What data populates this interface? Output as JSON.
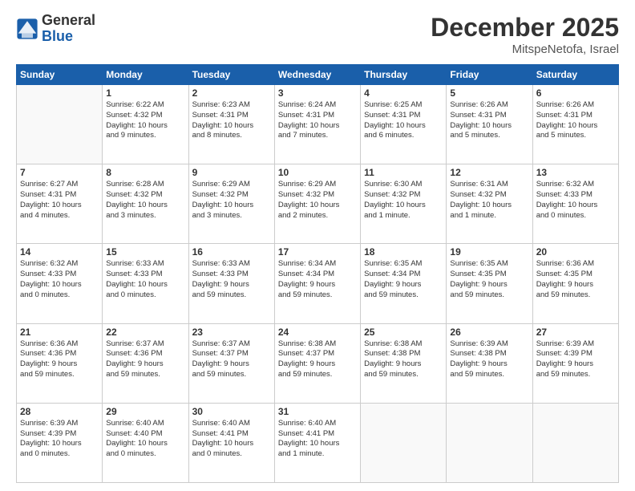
{
  "logo": {
    "general": "General",
    "blue": "Blue"
  },
  "title": "December 2025",
  "subtitle": "MitspeNetofa, Israel",
  "headers": [
    "Sunday",
    "Monday",
    "Tuesday",
    "Wednesday",
    "Thursday",
    "Friday",
    "Saturday"
  ],
  "weeks": [
    [
      {
        "day": "",
        "info": ""
      },
      {
        "day": "1",
        "info": "Sunrise: 6:22 AM\nSunset: 4:32 PM\nDaylight: 10 hours\nand 9 minutes."
      },
      {
        "day": "2",
        "info": "Sunrise: 6:23 AM\nSunset: 4:31 PM\nDaylight: 10 hours\nand 8 minutes."
      },
      {
        "day": "3",
        "info": "Sunrise: 6:24 AM\nSunset: 4:31 PM\nDaylight: 10 hours\nand 7 minutes."
      },
      {
        "day": "4",
        "info": "Sunrise: 6:25 AM\nSunset: 4:31 PM\nDaylight: 10 hours\nand 6 minutes."
      },
      {
        "day": "5",
        "info": "Sunrise: 6:26 AM\nSunset: 4:31 PM\nDaylight: 10 hours\nand 5 minutes."
      },
      {
        "day": "6",
        "info": "Sunrise: 6:26 AM\nSunset: 4:31 PM\nDaylight: 10 hours\nand 5 minutes."
      }
    ],
    [
      {
        "day": "7",
        "info": "Sunrise: 6:27 AM\nSunset: 4:31 PM\nDaylight: 10 hours\nand 4 minutes."
      },
      {
        "day": "8",
        "info": "Sunrise: 6:28 AM\nSunset: 4:32 PM\nDaylight: 10 hours\nand 3 minutes."
      },
      {
        "day": "9",
        "info": "Sunrise: 6:29 AM\nSunset: 4:32 PM\nDaylight: 10 hours\nand 3 minutes."
      },
      {
        "day": "10",
        "info": "Sunrise: 6:29 AM\nSunset: 4:32 PM\nDaylight: 10 hours\nand 2 minutes."
      },
      {
        "day": "11",
        "info": "Sunrise: 6:30 AM\nSunset: 4:32 PM\nDaylight: 10 hours\nand 1 minute."
      },
      {
        "day": "12",
        "info": "Sunrise: 6:31 AM\nSunset: 4:32 PM\nDaylight: 10 hours\nand 1 minute."
      },
      {
        "day": "13",
        "info": "Sunrise: 6:32 AM\nSunset: 4:33 PM\nDaylight: 10 hours\nand 0 minutes."
      }
    ],
    [
      {
        "day": "14",
        "info": "Sunrise: 6:32 AM\nSunset: 4:33 PM\nDaylight: 10 hours\nand 0 minutes."
      },
      {
        "day": "15",
        "info": "Sunrise: 6:33 AM\nSunset: 4:33 PM\nDaylight: 10 hours\nand 0 minutes."
      },
      {
        "day": "16",
        "info": "Sunrise: 6:33 AM\nSunset: 4:33 PM\nDaylight: 9 hours\nand 59 minutes."
      },
      {
        "day": "17",
        "info": "Sunrise: 6:34 AM\nSunset: 4:34 PM\nDaylight: 9 hours\nand 59 minutes."
      },
      {
        "day": "18",
        "info": "Sunrise: 6:35 AM\nSunset: 4:34 PM\nDaylight: 9 hours\nand 59 minutes."
      },
      {
        "day": "19",
        "info": "Sunrise: 6:35 AM\nSunset: 4:35 PM\nDaylight: 9 hours\nand 59 minutes."
      },
      {
        "day": "20",
        "info": "Sunrise: 6:36 AM\nSunset: 4:35 PM\nDaylight: 9 hours\nand 59 minutes."
      }
    ],
    [
      {
        "day": "21",
        "info": "Sunrise: 6:36 AM\nSunset: 4:36 PM\nDaylight: 9 hours\nand 59 minutes."
      },
      {
        "day": "22",
        "info": "Sunrise: 6:37 AM\nSunset: 4:36 PM\nDaylight: 9 hours\nand 59 minutes."
      },
      {
        "day": "23",
        "info": "Sunrise: 6:37 AM\nSunset: 4:37 PM\nDaylight: 9 hours\nand 59 minutes."
      },
      {
        "day": "24",
        "info": "Sunrise: 6:38 AM\nSunset: 4:37 PM\nDaylight: 9 hours\nand 59 minutes."
      },
      {
        "day": "25",
        "info": "Sunrise: 6:38 AM\nSunset: 4:38 PM\nDaylight: 9 hours\nand 59 minutes."
      },
      {
        "day": "26",
        "info": "Sunrise: 6:39 AM\nSunset: 4:38 PM\nDaylight: 9 hours\nand 59 minutes."
      },
      {
        "day": "27",
        "info": "Sunrise: 6:39 AM\nSunset: 4:39 PM\nDaylight: 9 hours\nand 59 minutes."
      }
    ],
    [
      {
        "day": "28",
        "info": "Sunrise: 6:39 AM\nSunset: 4:39 PM\nDaylight: 10 hours\nand 0 minutes."
      },
      {
        "day": "29",
        "info": "Sunrise: 6:40 AM\nSunset: 4:40 PM\nDaylight: 10 hours\nand 0 minutes."
      },
      {
        "day": "30",
        "info": "Sunrise: 6:40 AM\nSunset: 4:41 PM\nDaylight: 10 hours\nand 0 minutes."
      },
      {
        "day": "31",
        "info": "Sunrise: 6:40 AM\nSunset: 4:41 PM\nDaylight: 10 hours\nand 1 minute."
      },
      {
        "day": "",
        "info": ""
      },
      {
        "day": "",
        "info": ""
      },
      {
        "day": "",
        "info": ""
      }
    ]
  ]
}
